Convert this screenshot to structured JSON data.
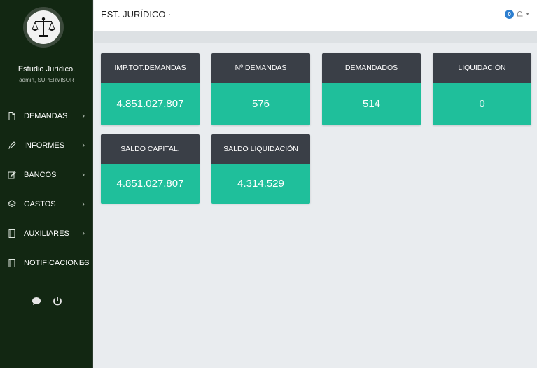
{
  "sidebar": {
    "org_name": "Estudio Jurídico.",
    "user": "admin, SUPERVISOR",
    "items": [
      {
        "label": "DEMANDAS",
        "icon": "file-icon"
      },
      {
        "label": "INFORMES",
        "icon": "pencil-icon"
      },
      {
        "label": "BANCOS",
        "icon": "edit-icon"
      },
      {
        "label": "GASTOS",
        "icon": "layers-icon"
      },
      {
        "label": "AUXILIARES",
        "icon": "book-icon"
      },
      {
        "label": "NOTIFICACIONES",
        "icon": "book-icon"
      }
    ],
    "chevron": "›"
  },
  "topbar": {
    "title": "EST. JURÍDICO ·",
    "notification_count": "0"
  },
  "cards": [
    {
      "title": "IMP.TOT.DEMANDAS",
      "value": "4.851.027.807"
    },
    {
      "title": "Nº DEMANDAS",
      "value": "576"
    },
    {
      "title": "DEMANDADOS",
      "value": "514"
    },
    {
      "title": "LIQUIDACIÓN",
      "value": "0"
    },
    {
      "title": "SALDO CAPITAL.",
      "value": "4.851.027.807"
    },
    {
      "title": "SALDO LIQUIDACIÓN",
      "value": "4.314.529"
    }
  ],
  "colors": {
    "sidebar_bg": "#122712",
    "card_header": "#3a3f47",
    "card_value": "#1fbf9b",
    "badge": "#2e7fd0"
  }
}
